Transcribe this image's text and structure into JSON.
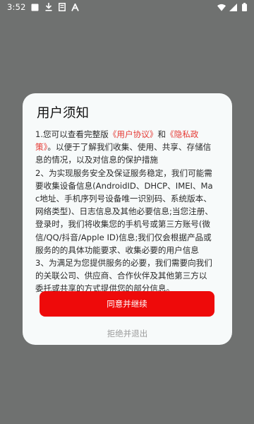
{
  "status_bar": {
    "time": "3:52",
    "left_icons": [
      "notification-square-icon",
      "download-icon",
      "document-icon",
      "a-letter-icon"
    ],
    "right_icons": [
      "wifi-icon",
      "signal-icon",
      "battery-icon"
    ]
  },
  "dialog": {
    "title": "用户须知",
    "intro_prefix": "1.您可以查看完整版",
    "user_agreement_link": "《用户协议》",
    "and_text": "和",
    "privacy_policy_link": "《隐私政策》",
    "intro_suffix": "。以便于了解我们收集、使用、共享、存储信息的情况，以及对信息的保护措施",
    "paragraph_2": "2、为实现服务安全及保证服务稳定，我们可能需要收集设备信息(AndroidID、DHCP、IMEI、Mac地址、手机序列号设备唯一识别码、系统版本、网络类型)、日志信息及其他必要信息;当您注册、登录时，我们将收集您的手机号或第三方账号(微信/QQ/抖音/Apple ID)信息;我们仅会根据产品或服务的的具体功能要求、收集必要的用户信息",
    "paragraph_3": "3、为满足为您提供服务的必要，我们需要向我们的关联公司、供应商、合作伙伴及其他第三方以委托或共享的方式提供您的部分信息。",
    "confirm_label": "同意并继续",
    "reject_label": "拒绝并退出"
  },
  "colors": {
    "overlay": "#6f7170",
    "dialog_bg": "#f7fafa",
    "accent": "#ee0a0a",
    "link": "#e53b35",
    "muted": "#9c9c9c"
  }
}
